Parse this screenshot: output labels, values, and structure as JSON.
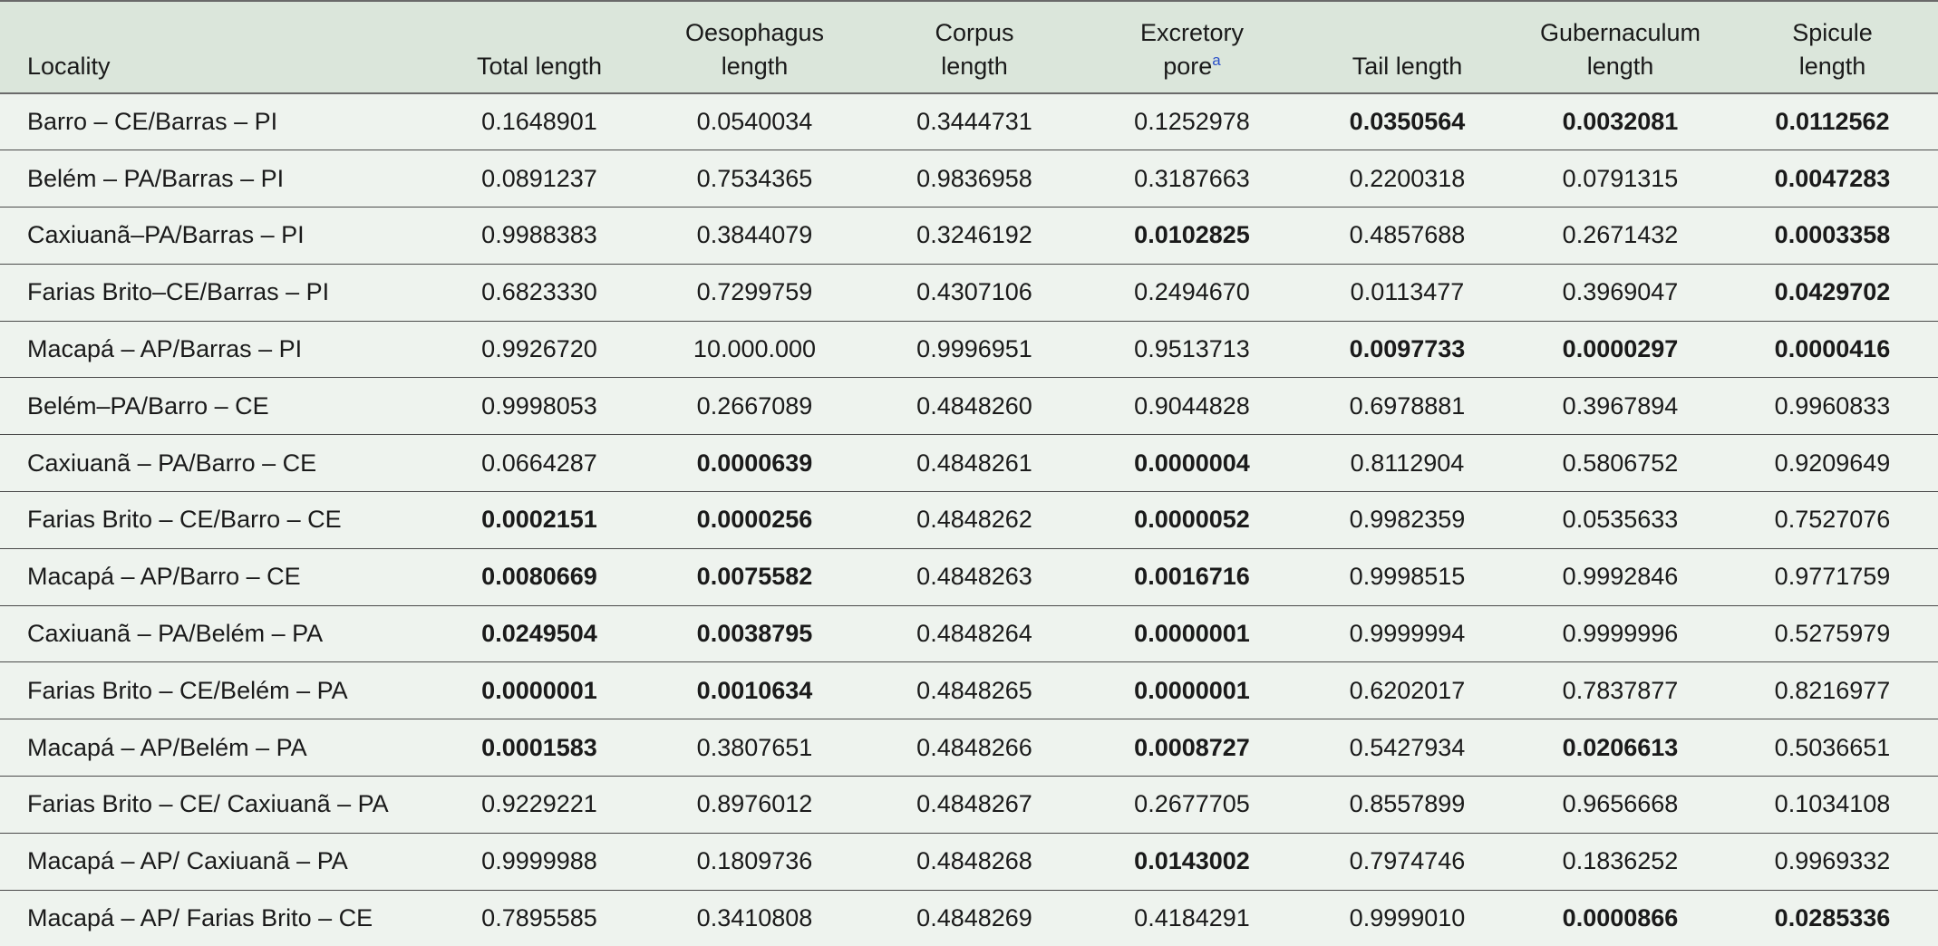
{
  "table": {
    "headers": [
      {
        "lines": [
          "Locality"
        ]
      },
      {
        "lines": [
          "Total length"
        ]
      },
      {
        "lines": [
          "Oesophagus",
          "length"
        ]
      },
      {
        "lines": [
          "Corpus",
          "length"
        ]
      },
      {
        "lines": [
          "Excretory",
          "pore"
        ],
        "sup": "a"
      },
      {
        "lines": [
          "Tail length"
        ]
      },
      {
        "lines": [
          "Gubernaculum",
          "length"
        ]
      },
      {
        "lines": [
          "Spicule",
          "length"
        ]
      }
    ],
    "rows": [
      {
        "locality": "Barro – CE/Barras – PI",
        "cells": [
          {
            "v": "0.1648901",
            "b": false
          },
          {
            "v": "0.0540034",
            "b": false
          },
          {
            "v": "0.3444731",
            "b": false
          },
          {
            "v": "0.1252978",
            "b": false
          },
          {
            "v": "0.0350564",
            "b": true
          },
          {
            "v": "0.0032081",
            "b": true
          },
          {
            "v": "0.0112562",
            "b": true
          }
        ]
      },
      {
        "locality": "Belém – PA/Barras – PI",
        "cells": [
          {
            "v": "0.0891237",
            "b": false
          },
          {
            "v": "0.7534365",
            "b": false
          },
          {
            "v": "0.9836958",
            "b": false
          },
          {
            "v": "0.3187663",
            "b": false
          },
          {
            "v": "0.2200318",
            "b": false
          },
          {
            "v": "0.0791315",
            "b": false
          },
          {
            "v": "0.0047283",
            "b": true
          }
        ]
      },
      {
        "locality": "Caxiuanã–PA/Barras – PI",
        "cells": [
          {
            "v": "0.9988383",
            "b": false
          },
          {
            "v": "0.3844079",
            "b": false
          },
          {
            "v": "0.3246192",
            "b": false
          },
          {
            "v": "0.0102825",
            "b": true
          },
          {
            "v": "0.4857688",
            "b": false
          },
          {
            "v": "0.2671432",
            "b": false
          },
          {
            "v": "0.0003358",
            "b": true
          }
        ]
      },
      {
        "locality": "Farias Brito–CE/Barras – PI",
        "cells": [
          {
            "v": "0.6823330",
            "b": false
          },
          {
            "v": "0.7299759",
            "b": false
          },
          {
            "v": "0.4307106",
            "b": false
          },
          {
            "v": "0.2494670",
            "b": false
          },
          {
            "v": "0.0113477",
            "b": false
          },
          {
            "v": "0.3969047",
            "b": false
          },
          {
            "v": "0.0429702",
            "b": true
          }
        ]
      },
      {
        "locality": "Macapá – AP/Barras – PI",
        "cells": [
          {
            "v": "0.9926720",
            "b": false
          },
          {
            "v": "10.000.000",
            "b": false
          },
          {
            "v": "0.9996951",
            "b": false
          },
          {
            "v": "0.9513713",
            "b": false
          },
          {
            "v": "0.0097733",
            "b": true
          },
          {
            "v": "0.0000297",
            "b": true
          },
          {
            "v": "0.0000416",
            "b": true
          }
        ]
      },
      {
        "locality": "Belém–PA/Barro – CE",
        "cells": [
          {
            "v": "0.9998053",
            "b": false
          },
          {
            "v": "0.2667089",
            "b": false
          },
          {
            "v": "0.4848260",
            "b": false
          },
          {
            "v": "0.9044828",
            "b": false
          },
          {
            "v": "0.6978881",
            "b": false
          },
          {
            "v": "0.3967894",
            "b": false
          },
          {
            "v": "0.9960833",
            "b": false
          }
        ]
      },
      {
        "locality": "Caxiuanã – PA/Barro – CE",
        "cells": [
          {
            "v": "0.0664287",
            "b": false
          },
          {
            "v": "0.0000639",
            "b": true
          },
          {
            "v": "0.4848261",
            "b": false
          },
          {
            "v": "0.0000004",
            "b": true
          },
          {
            "v": "0.8112904",
            "b": false
          },
          {
            "v": "0.5806752",
            "b": false
          },
          {
            "v": "0.9209649",
            "b": false
          }
        ]
      },
      {
        "locality": "Farias Brito – CE/Barro – CE",
        "cells": [
          {
            "v": "0.0002151",
            "b": true
          },
          {
            "v": "0.0000256",
            "b": true
          },
          {
            "v": "0.4848262",
            "b": false
          },
          {
            "v": "0.0000052",
            "b": true
          },
          {
            "v": "0.9982359",
            "b": false
          },
          {
            "v": "0.0535633",
            "b": false
          },
          {
            "v": "0.7527076",
            "b": false
          }
        ]
      },
      {
        "locality": "Macapá – AP/Barro – CE",
        "cells": [
          {
            "v": "0.0080669",
            "b": true
          },
          {
            "v": "0.0075582",
            "b": true
          },
          {
            "v": "0.4848263",
            "b": false
          },
          {
            "v": "0.0016716",
            "b": true
          },
          {
            "v": "0.9998515",
            "b": false
          },
          {
            "v": "0.9992846",
            "b": false
          },
          {
            "v": "0.9771759",
            "b": false
          }
        ]
      },
      {
        "locality": "Caxiuanã – PA/Belém – PA",
        "cells": [
          {
            "v": "0.0249504",
            "b": true
          },
          {
            "v": "0.0038795",
            "b": true
          },
          {
            "v": "0.4848264",
            "b": false
          },
          {
            "v": "0.0000001",
            "b": true
          },
          {
            "v": "0.9999994",
            "b": false
          },
          {
            "v": "0.9999996",
            "b": false
          },
          {
            "v": "0.5275979",
            "b": false
          }
        ]
      },
      {
        "locality": "Farias Brito – CE/Belém – PA",
        "cells": [
          {
            "v": "0.0000001",
            "b": true
          },
          {
            "v": "0.0010634",
            "b": true
          },
          {
            "v": "0.4848265",
            "b": false
          },
          {
            "v": "0.0000001",
            "b": true
          },
          {
            "v": "0.6202017",
            "b": false
          },
          {
            "v": "0.7837877",
            "b": false
          },
          {
            "v": "0.8216977",
            "b": false
          }
        ]
      },
      {
        "locality": "Macapá – AP/Belém – PA",
        "cells": [
          {
            "v": "0.0001583",
            "b": true
          },
          {
            "v": "0.3807651",
            "b": false
          },
          {
            "v": "0.4848266",
            "b": false
          },
          {
            "v": "0.0008727",
            "b": true
          },
          {
            "v": "0.5427934",
            "b": false
          },
          {
            "v": "0.0206613",
            "b": true
          },
          {
            "v": "0.5036651",
            "b": false
          }
        ]
      },
      {
        "locality": "Farias Brito – CE/ Caxiuanã – PA",
        "cells": [
          {
            "v": "0.9229221",
            "b": false
          },
          {
            "v": "0.8976012",
            "b": false
          },
          {
            "v": "0.4848267",
            "b": false
          },
          {
            "v": "0.2677705",
            "b": false
          },
          {
            "v": "0.8557899",
            "b": false
          },
          {
            "v": "0.9656668",
            "b": false
          },
          {
            "v": "0.1034108",
            "b": false
          }
        ]
      },
      {
        "locality": "Macapá – AP/ Caxiuanã – PA",
        "cells": [
          {
            "v": "0.9999988",
            "b": false
          },
          {
            "v": "0.1809736",
            "b": false
          },
          {
            "v": "0.4848268",
            "b": false
          },
          {
            "v": "0.0143002",
            "b": true
          },
          {
            "v": "0.7974746",
            "b": false
          },
          {
            "v": "0.1836252",
            "b": false
          },
          {
            "v": "0.9969332",
            "b": false
          }
        ]
      },
      {
        "locality": "Macapá – AP/ Farias Brito – CE",
        "cells": [
          {
            "v": "0.7895585",
            "b": false
          },
          {
            "v": "0.3410808",
            "b": false
          },
          {
            "v": "0.4848269",
            "b": false
          },
          {
            "v": "0.4184291",
            "b": false
          },
          {
            "v": "0.9999010",
            "b": false
          },
          {
            "v": "0.0000866",
            "b": true
          },
          {
            "v": "0.0285336",
            "b": true
          }
        ]
      }
    ]
  }
}
